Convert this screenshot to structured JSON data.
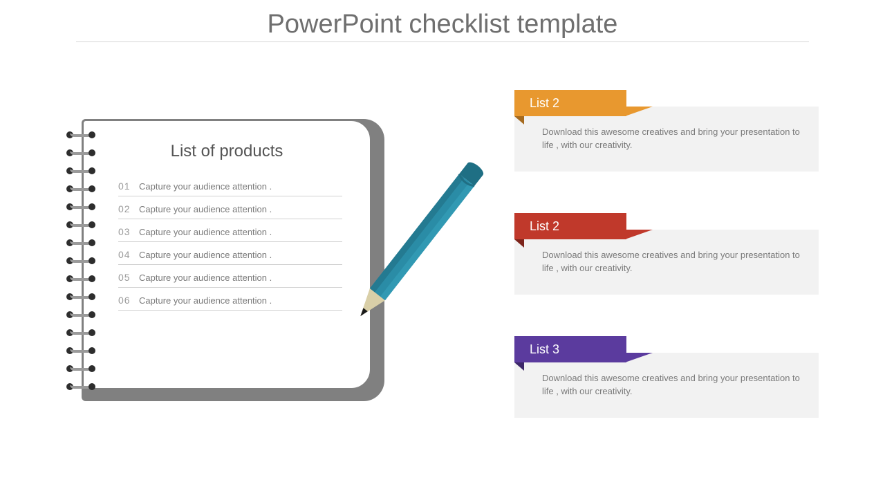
{
  "title": "PowerPoint checklist template",
  "notepad": {
    "heading": "List of products",
    "rows": [
      {
        "num": "01",
        "text": "Capture your audience attention ."
      },
      {
        "num": "02",
        "text": "Capture your audience attention ."
      },
      {
        "num": "03",
        "text": "Capture your audience attention ."
      },
      {
        "num": "04",
        "text": "Capture your audience attention ."
      },
      {
        "num": "05",
        "text": "Capture your audience attention ."
      },
      {
        "num": "06",
        "text": "Capture your audience attention ."
      }
    ]
  },
  "cards": [
    {
      "label": "List 2",
      "color": "orange",
      "body": "Download this awesome creatives and bring your presentation to life , with our creativity."
    },
    {
      "label": "List 2",
      "color": "red",
      "body": "Download this awesome creatives and bring your presentation to life , with our creativity."
    },
    {
      "label": "List 3",
      "color": "purple",
      "body": "Download this awesome creatives and bring your presentation to life , with our creativity."
    }
  ]
}
